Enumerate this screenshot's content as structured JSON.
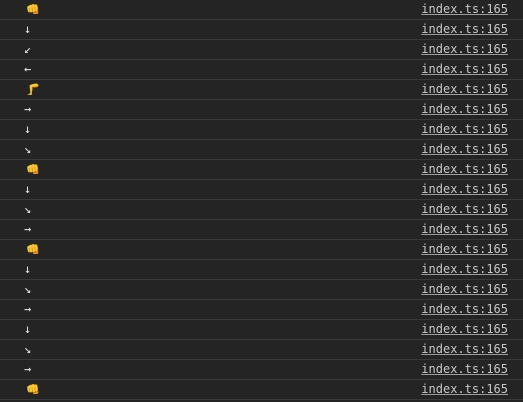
{
  "console": {
    "rows": [
      {
        "message": "👊",
        "icon": "fist-icon",
        "source": "index.ts:165"
      },
      {
        "message": "↓",
        "icon": "arrow-down-icon",
        "source": "index.ts:165"
      },
      {
        "message": "↙",
        "icon": "arrow-down-left-icon",
        "source": "index.ts:165"
      },
      {
        "message": "←",
        "icon": "arrow-left-icon",
        "source": "index.ts:165"
      },
      {
        "message": "🦵",
        "icon": "leg-icon",
        "source": "index.ts:165"
      },
      {
        "message": "→",
        "icon": "arrow-right-icon",
        "source": "index.ts:165"
      },
      {
        "message": "↓",
        "icon": "arrow-down-icon",
        "source": "index.ts:165"
      },
      {
        "message": "↘",
        "icon": "arrow-down-right-icon",
        "source": "index.ts:165"
      },
      {
        "message": "👊",
        "icon": "fist-icon",
        "source": "index.ts:165"
      },
      {
        "message": "↓",
        "icon": "arrow-down-icon",
        "source": "index.ts:165"
      },
      {
        "message": "↘",
        "icon": "arrow-down-right-icon",
        "source": "index.ts:165"
      },
      {
        "message": "→",
        "icon": "arrow-right-icon",
        "source": "index.ts:165"
      },
      {
        "message": "👊",
        "icon": "fist-icon",
        "source": "index.ts:165"
      },
      {
        "message": "↓",
        "icon": "arrow-down-icon",
        "source": "index.ts:165"
      },
      {
        "message": "↘",
        "icon": "arrow-down-right-icon",
        "source": "index.ts:165"
      },
      {
        "message": "→",
        "icon": "arrow-right-icon",
        "source": "index.ts:165"
      },
      {
        "message": "↓",
        "icon": "arrow-down-icon",
        "source": "index.ts:165"
      },
      {
        "message": "↘",
        "icon": "arrow-down-right-icon",
        "source": "index.ts:165"
      },
      {
        "message": "→",
        "icon": "arrow-right-icon",
        "source": "index.ts:165"
      },
      {
        "message": "👊",
        "icon": "fist-icon",
        "source": "index.ts:165"
      }
    ]
  }
}
